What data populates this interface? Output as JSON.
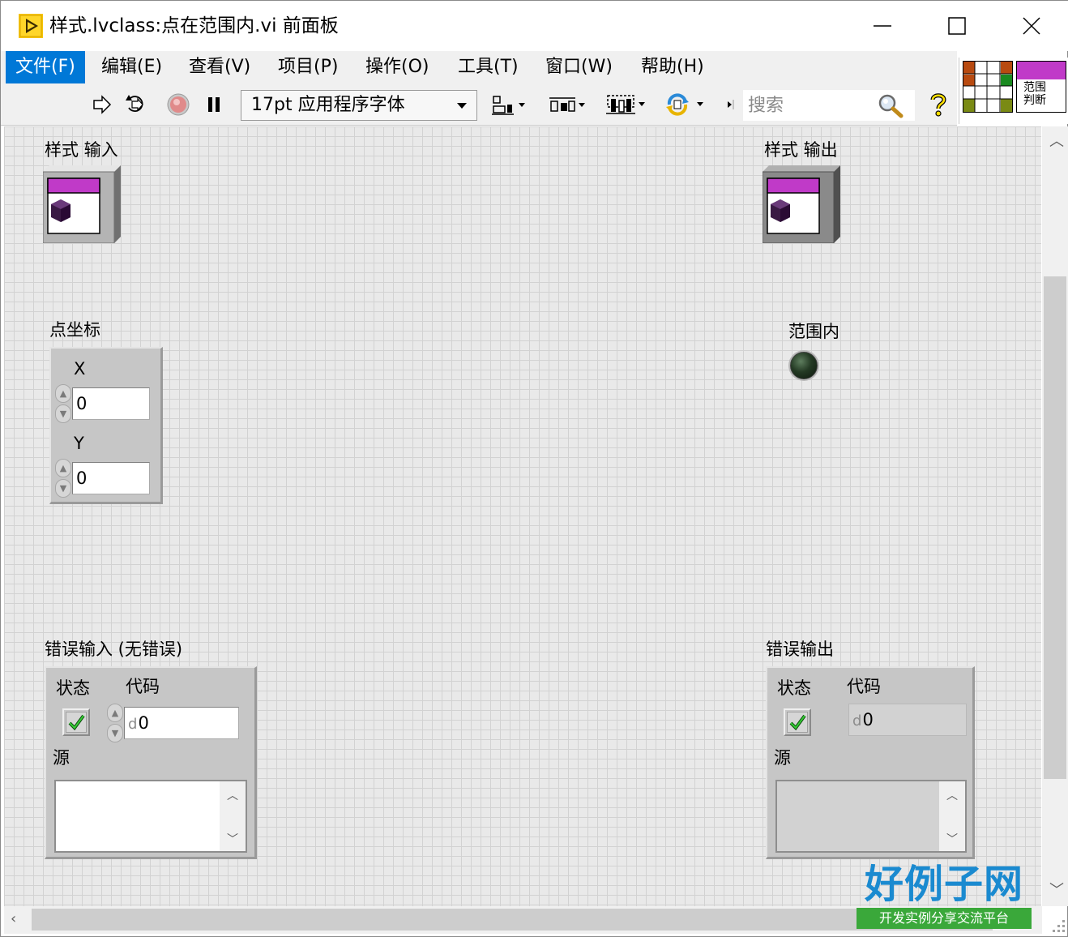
{
  "window": {
    "title": "样式.lvclass:点在范围内.vi 前面板"
  },
  "menu": {
    "items": [
      "文件(F)",
      "编辑(E)",
      "查看(V)",
      "项目(P)",
      "操作(O)",
      "工具(T)",
      "窗口(W)",
      "帮助(H)"
    ]
  },
  "toolbar": {
    "font": "17pt 应用程序字体",
    "search_placeholder": "搜索"
  },
  "vi_icon": {
    "caption_line1": "范围",
    "caption_line2": "判断"
  },
  "panel": {
    "style_in": {
      "label": "样式 输入"
    },
    "style_out": {
      "label": "样式 输出"
    },
    "point": {
      "label": "点坐标",
      "x_label": "X",
      "x_value": "0",
      "y_label": "Y",
      "y_value": "0"
    },
    "in_range": {
      "label": "范围内"
    },
    "error_in": {
      "label": "错误输入 (无错误)",
      "status_label": "状态",
      "code_label": "代码",
      "code_radix": "d",
      "code_value": "0",
      "source_label": "源"
    },
    "error_out": {
      "label": "错误输出",
      "status_label": "状态",
      "code_label": "代码",
      "code_radix": "d",
      "code_value": "0",
      "source_label": "源"
    }
  },
  "brand": {
    "name": "好例子网",
    "tagline": "开发实例分享交流平台"
  },
  "colors": {
    "menu_active": "#0078d7",
    "panel_grid": "#e9e9e9",
    "class_wire": "#b040c0",
    "check": "#1faa1f"
  }
}
